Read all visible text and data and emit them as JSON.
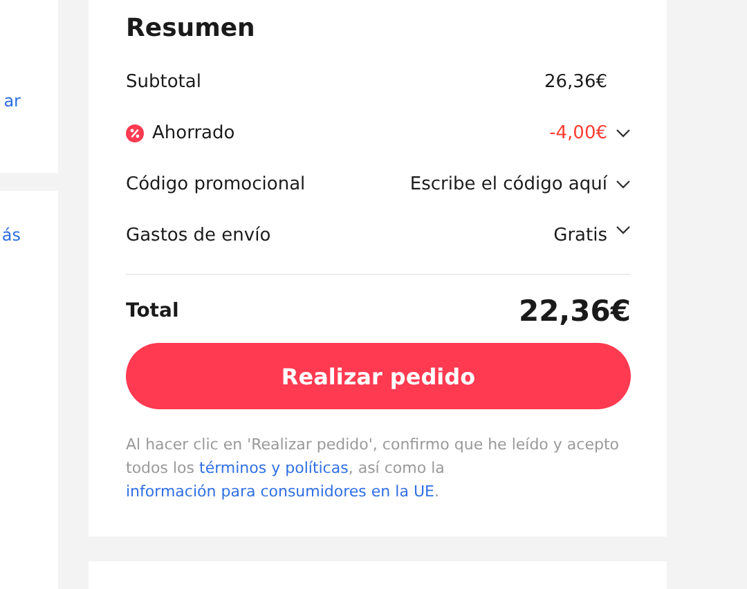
{
  "left_cards": [
    {
      "link": "ar"
    },
    {
      "link": "ás"
    }
  ],
  "summary": {
    "title": "Resumen",
    "rows": [
      {
        "kind": "plain",
        "label": "Subtotal",
        "value": "26,36€",
        "expandable": false
      },
      {
        "kind": "discount",
        "label": "Ahorrado",
        "value": "-4,00€",
        "expandable": true
      },
      {
        "kind": "promo",
        "label": "Código promocional",
        "value": "Escribe el código aquí",
        "expandable": true
      },
      {
        "kind": "plain",
        "label": "Gastos de envío",
        "value": "Gratis",
        "expandable": true
      }
    ],
    "total": {
      "label": "Total",
      "value": "22,36€"
    },
    "button": "Realizar pedido",
    "disclaimer": [
      {
        "kind": "text",
        "text": "Al hacer clic en 'Realizar pedido', confirmo que he leído y acepto todos los "
      },
      {
        "kind": "link",
        "text": "términos y políticas"
      },
      {
        "kind": "text",
        "text": ", así como la "
      },
      {
        "kind": "link",
        "text": "información para consumidores en la UE"
      },
      {
        "kind": "text",
        "text": "."
      }
    ]
  }
}
